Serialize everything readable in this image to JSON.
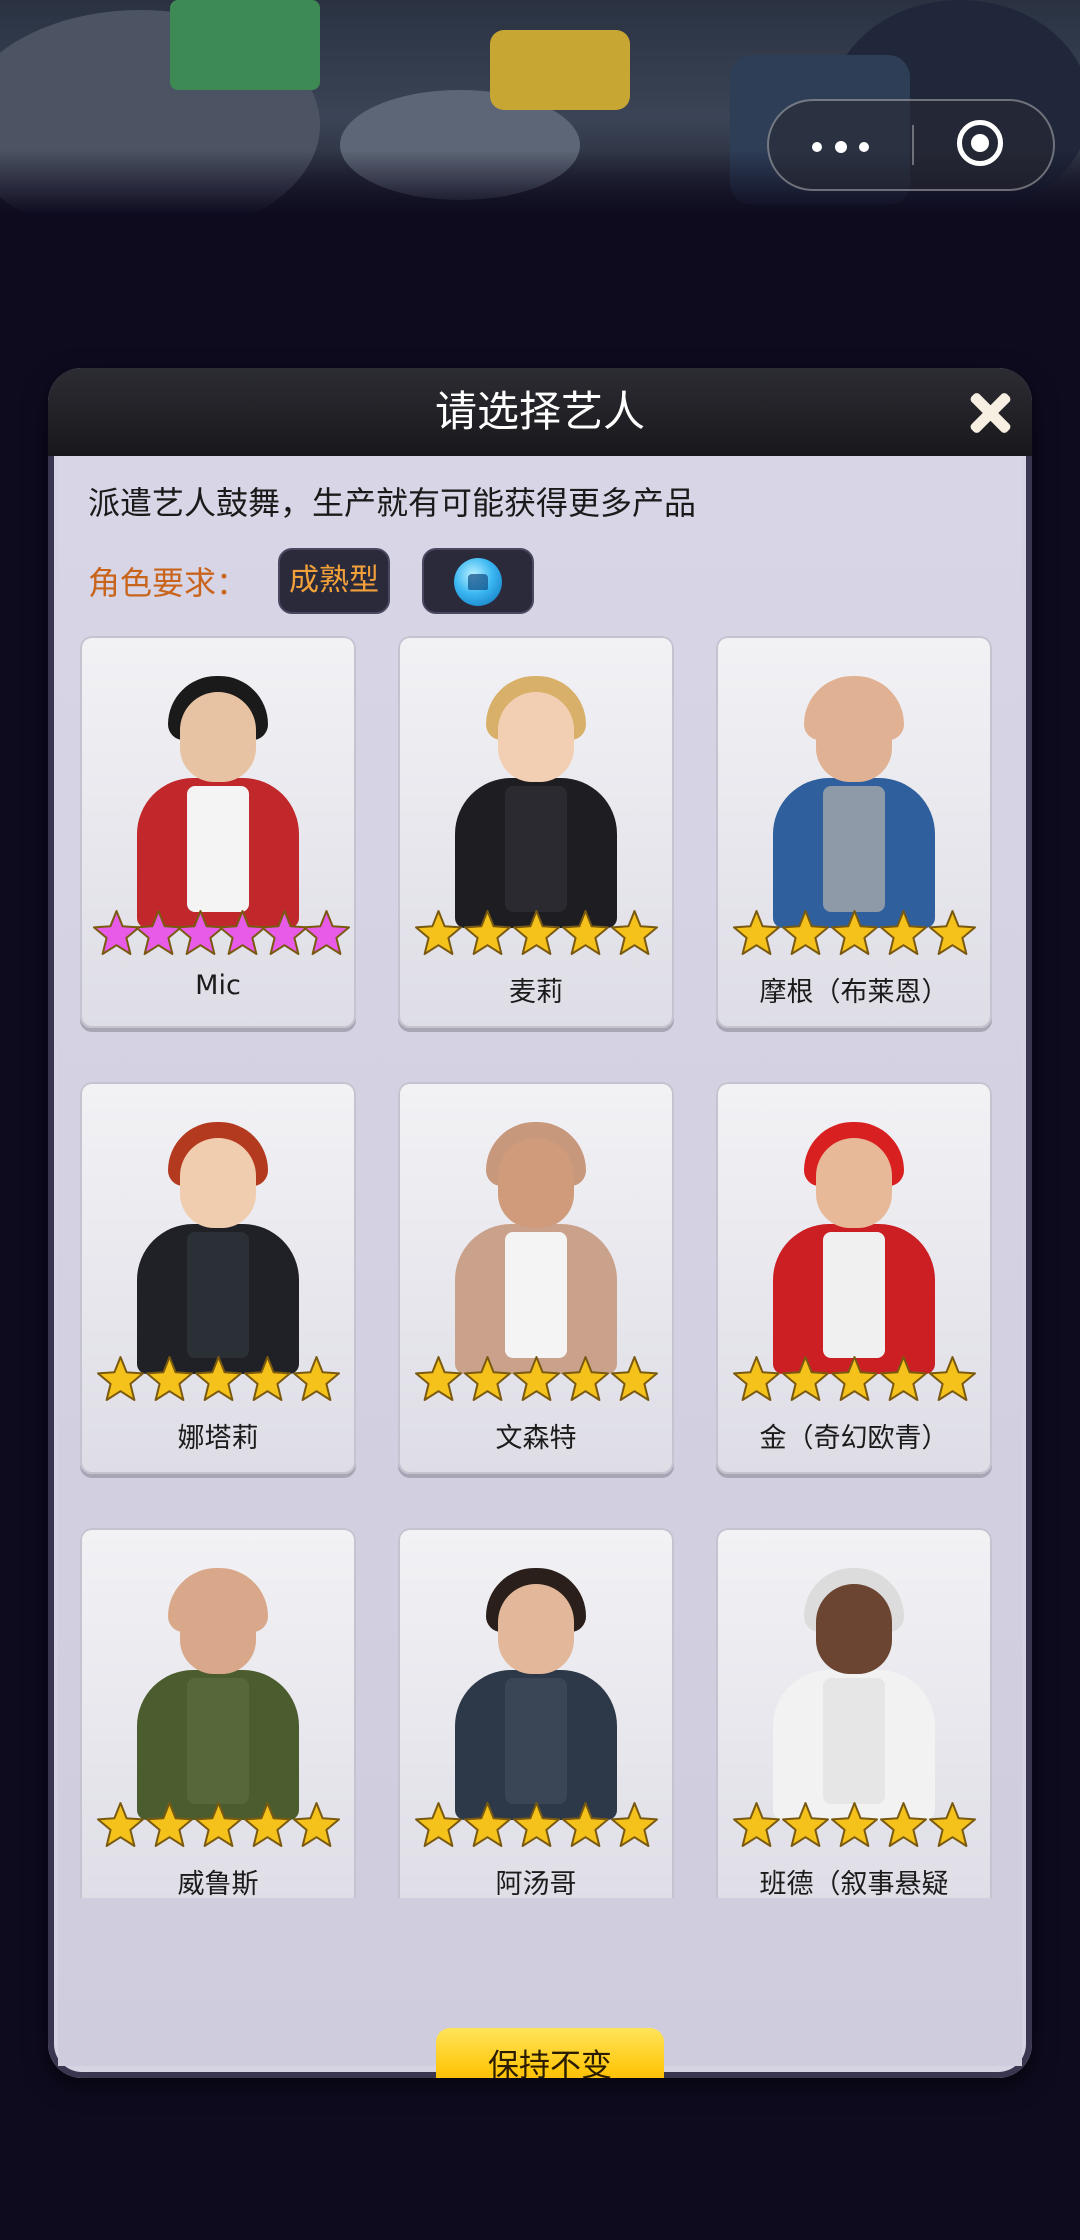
{
  "modal": {
    "title": "请选择艺人",
    "description": "派遣艺人鼓舞，生产就有可能获得更多产品",
    "requirement_label": "角色要求：",
    "requirement_tags": [
      {
        "text": "成熟型"
      },
      {
        "icon": "album-icon"
      }
    ],
    "keep_button": "保持不变"
  },
  "artists": [
    {
      "name": "Mic",
      "stars": 6,
      "star_color": "#e85be8"
    },
    {
      "name": "麦莉",
      "stars": 5,
      "star_color": "#f5c21b"
    },
    {
      "name": "摩根（布莱恩）",
      "stars": 5,
      "star_color": "#f5c21b"
    },
    {
      "name": "娜塔莉",
      "stars": 5,
      "star_color": "#f5c21b"
    },
    {
      "name": "文森特",
      "stars": 5,
      "star_color": "#f5c21b"
    },
    {
      "name": "金（奇幻欧青）",
      "stars": 5,
      "star_color": "#f5c21b"
    },
    {
      "name": "威鲁斯",
      "stars": 5,
      "star_color": "#f5c21b"
    },
    {
      "name": "阿汤哥",
      "stars": 5,
      "star_color": "#f5c21b"
    },
    {
      "name": "班德（叙事悬疑",
      "stars": 5,
      "star_color": "#f5c21b"
    }
  ],
  "colors": {
    "accent_orange": "#c9641c",
    "button_yellow": "#ffc70e",
    "header_dark": "#1f1f24"
  }
}
